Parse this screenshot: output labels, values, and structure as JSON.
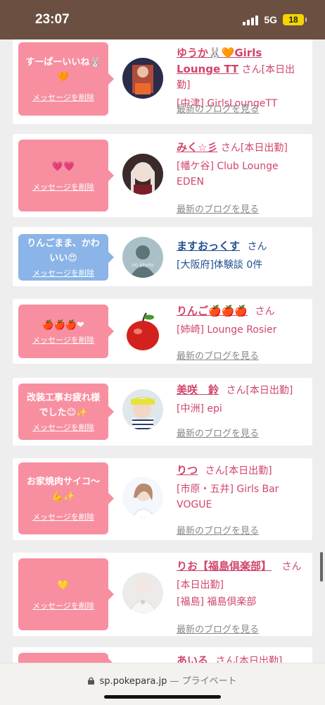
{
  "status": {
    "time": "23:07",
    "network": "5G",
    "battery": "18"
  },
  "cards": [
    {
      "bubble_color": "pink",
      "message": "すーぱーいいね🐰🧡",
      "delete_label": "メッセージを削除",
      "name_line": "ゆうか🐰🧡Girls Lounge TT",
      "san": "さん",
      "status": "[本日出勤]",
      "shop": "[中津] GirlsLoungeTT",
      "blog": "最新のブログを見る"
    },
    {
      "bubble_color": "pink",
      "message": "💗💗",
      "delete_label": "メッセージを削除",
      "name_line": "みく☆彡",
      "san": "さん",
      "status": "[本日出勤]",
      "shop": "[幡ケ谷] Club Lounge EDEN",
      "blog": "最新のブログを見る"
    },
    {
      "bubble_color": "blue",
      "message": "りんごまま、かわいい😍",
      "delete_label": "メッセージを削除",
      "name_line": "ますおっくす",
      "san": "さん",
      "status": "",
      "shop": "[大阪府]体験談 0件",
      "avatar_label": "no photo",
      "blog": ""
    },
    {
      "bubble_color": "pink",
      "message": "🍎🍎🍎❤",
      "delete_label": "メッセージを削除",
      "name_line": "りんご🍎🍎🍎",
      "san": "さん",
      "status": "",
      "shop": "[姉崎] Lounge Rosier",
      "blog": "最新のブログを見る"
    },
    {
      "bubble_color": "pink",
      "message": "改装工事お疲れ様でした😊✨",
      "delete_label": "メッセージを削除",
      "name_line": "美咲　鈴",
      "san": "さん",
      "status": "[本日出勤]",
      "shop": "[中洲] epi",
      "blog": "最新のブログを見る"
    },
    {
      "bubble_color": "pink",
      "message": "お家焼肉サイコ〜💪✨",
      "delete_label": "メッセージを削除",
      "name_line": "りつ",
      "san": "さん",
      "status": "[本日出勤]",
      "shop": "[市原・五井] Girls Bar VOGUE",
      "blog": "最新のブログを見る"
    },
    {
      "bubble_color": "pink",
      "message": "💛",
      "delete_label": "メッセージを削除",
      "name_line": "りお【福島倶楽部】",
      "san": "さん",
      "status": "[本日出勤]",
      "shop": "[福島] 福島倶楽部",
      "blog": "最新のブログを見る"
    },
    {
      "bubble_color": "pink",
      "message": "",
      "delete_label": "",
      "name_line": "あいる",
      "san": "さん",
      "status": "[本日出勤]",
      "shop": "",
      "blog": ""
    }
  ],
  "urlbar": {
    "domain": "sp.pokepara.jp",
    "separator": "—",
    "mode": "プライベート"
  },
  "colors": {
    "accent_pink": "#f78fa0",
    "accent_blue": "#8bb4e8",
    "name_pink": "#d1456a",
    "status_bar": "#6b5041"
  }
}
